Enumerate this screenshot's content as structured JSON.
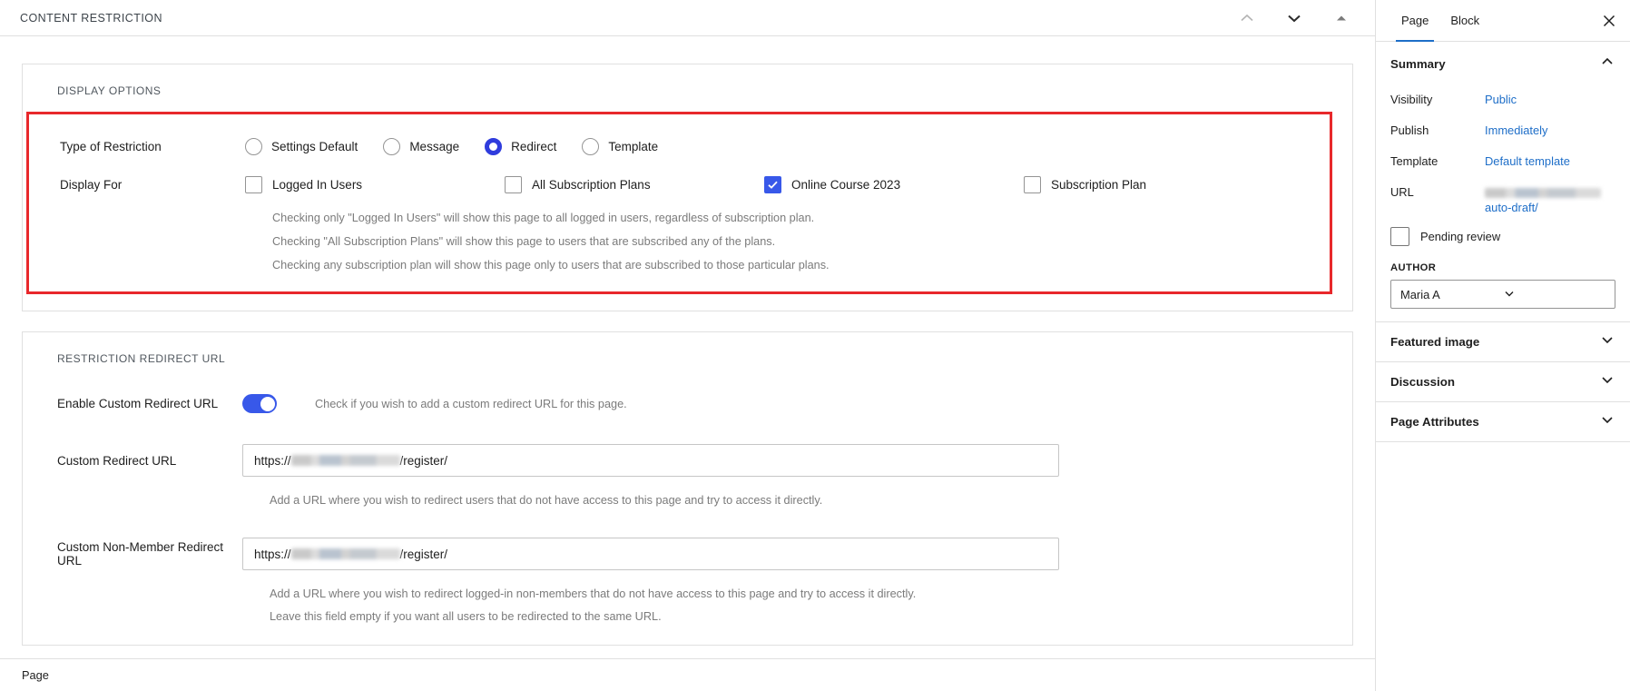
{
  "panel": {
    "title": "CONTENT RESTRICTION",
    "icons": [
      {
        "name": "chevron-up-icon",
        "label": "Move up"
      },
      {
        "name": "chevron-down-icon",
        "label": "Move down"
      },
      {
        "name": "caret-up-icon",
        "label": "Collapse"
      }
    ]
  },
  "display_options": {
    "section_title": "DISPLAY OPTIONS",
    "type_of_restriction": {
      "label": "Type of Restriction",
      "selected": "Redirect",
      "options": [
        {
          "label": "Settings Default",
          "checked": false
        },
        {
          "label": "Message",
          "checked": false
        },
        {
          "label": "Redirect",
          "checked": true
        },
        {
          "label": "Template",
          "checked": false
        }
      ]
    },
    "display_for": {
      "label": "Display For",
      "options": [
        {
          "label": "Logged In Users",
          "checked": false
        },
        {
          "label": "All Subscription Plans",
          "checked": false
        },
        {
          "label": "Online Course 2023",
          "checked": true
        },
        {
          "label": "Subscription Plan",
          "checked": false
        }
      ]
    },
    "help_lines": [
      "Checking only \"Logged In Users\" will show this page to all logged in users, regardless of subscription plan.",
      "Checking \"All Subscription Plans\" will show this page to users that are subscribed any of the plans.",
      "Checking any subscription plan will show this page only to users that are subscribed to those particular plans."
    ]
  },
  "redirect_section": {
    "section_title": "RESTRICTION REDIRECT URL",
    "enable_toggle": {
      "label": "Enable Custom Redirect URL",
      "on": true,
      "help": "Check if you wish to add a custom redirect URL for this page."
    },
    "custom_redirect": {
      "label": "Custom Redirect URL",
      "value_prefix": "https://",
      "value_suffix": "/register/",
      "value_redacted": true,
      "help": "Add a URL where you wish to redirect users that do not have access to this page and try to access it directly."
    },
    "custom_non_member_redirect": {
      "label": "Custom Non-Member Redirect URL",
      "value_prefix": "https://",
      "value_suffix": "/register/",
      "value_redacted": true,
      "help_lines": [
        "Add a URL where you wish to redirect logged-in non-members that do not have access to this page and try to access it directly.",
        "Leave this field empty if you want all users to be redirected to the same URL."
      ]
    }
  },
  "statusbar": {
    "label": "Page"
  },
  "sidebar": {
    "tabs": [
      {
        "label": "Page",
        "active": true
      },
      {
        "label": "Block",
        "active": false
      }
    ],
    "close_label": "Close settings",
    "summary": {
      "title": "Summary",
      "expanded": true,
      "rows": [
        {
          "label": "Visibility",
          "value": "Public"
        },
        {
          "label": "Publish",
          "value": "Immediately"
        },
        {
          "label": "Template",
          "value": "Default template"
        }
      ],
      "url_row": {
        "label": "URL",
        "value_redacted": true,
        "value_suffix": "auto-draft/"
      },
      "pending_review": {
        "label": "Pending review",
        "checked": false
      },
      "author": {
        "label": "AUTHOR",
        "value": "Maria A"
      }
    },
    "sections": [
      {
        "title": "Featured image",
        "expanded": false
      },
      {
        "title": "Discussion",
        "expanded": false
      },
      {
        "title": "Page Attributes",
        "expanded": false
      }
    ]
  },
  "colors": {
    "accent_blue": "#3858e9",
    "radio_blue": "#2f3cdd",
    "link_blue": "#1e6ec8",
    "highlight_red": "#e8282b",
    "border_gray": "#e0e0e0",
    "help_gray": "#7b7b7b"
  }
}
